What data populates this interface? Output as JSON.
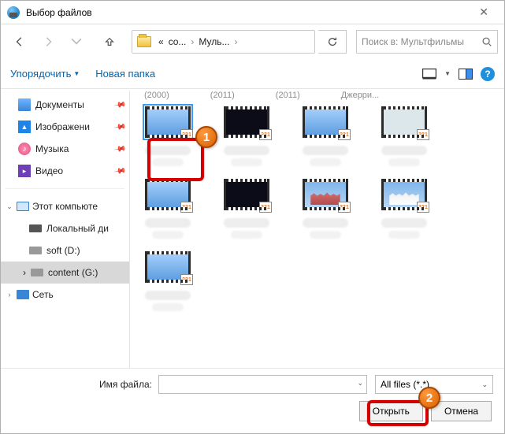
{
  "window": {
    "title": "Выбор файлов"
  },
  "breadcrumb": {
    "prefix": "«",
    "p1": "co...",
    "p2": "Муль..."
  },
  "search": {
    "placeholder": "Поиск в: Мультфильмы"
  },
  "toolbar": {
    "organize": "Упорядочить",
    "newfolder": "Новая папка"
  },
  "sidebar": {
    "docs": "Документы",
    "images": "Изображени",
    "music": "Музыка",
    "video": "Видео",
    "thispc": "Этот компьюте",
    "localdisk": "Локальный ди",
    "soft": "soft (D:)",
    "content": "content (G:)",
    "network": "Сеть"
  },
  "groups": {
    "g1": "(2000)",
    "g2": "(2011)",
    "g3": "(2011)",
    "g4": "Джерри..."
  },
  "footer": {
    "filename_label": "Имя файла:",
    "filter": "All files (*.*)",
    "open": "Открыть",
    "cancel": "Отмена"
  },
  "callouts": {
    "c1": "1",
    "c2": "2"
  }
}
